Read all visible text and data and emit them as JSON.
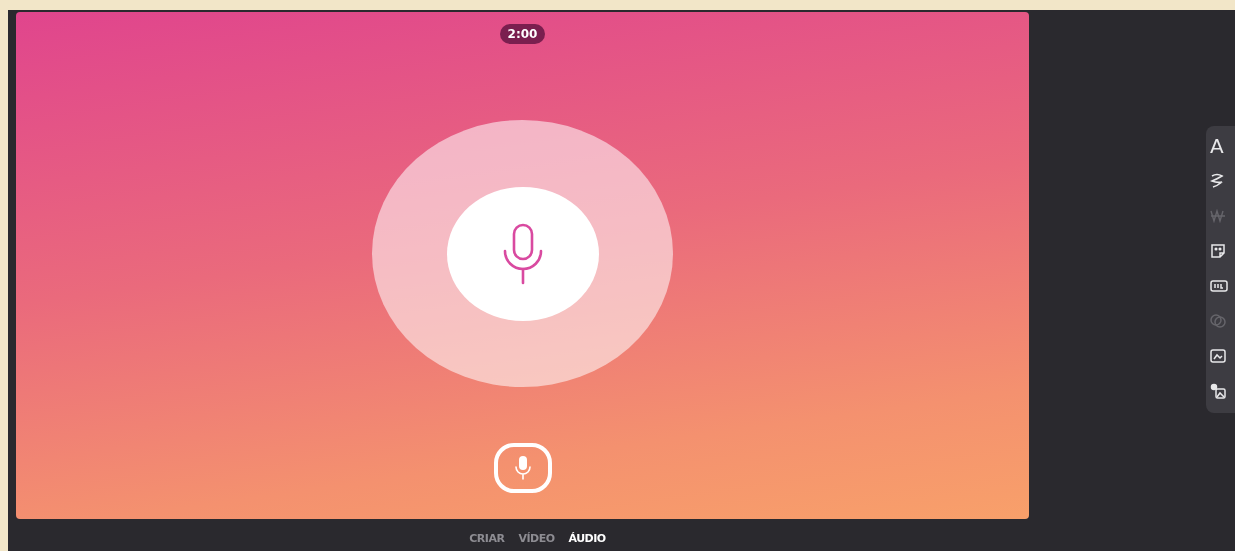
{
  "timer": "2:00",
  "modes": [
    {
      "label": "CRIAR",
      "selected": false
    },
    {
      "label": "VÍDEO",
      "selected": false
    },
    {
      "label": "ÁUDIO",
      "selected": true
    }
  ],
  "tools": [
    {
      "kind": "text",
      "label": "A",
      "disabled": false
    },
    {
      "kind": "squiggle",
      "disabled": false
    },
    {
      "kind": "pattern",
      "disabled": true
    },
    {
      "kind": "sticker",
      "disabled": false
    },
    {
      "kind": "gif",
      "disabled": false
    },
    {
      "kind": "circles",
      "disabled": true
    },
    {
      "kind": "frame",
      "disabled": false
    },
    {
      "kind": "image",
      "disabled": false
    }
  ]
}
